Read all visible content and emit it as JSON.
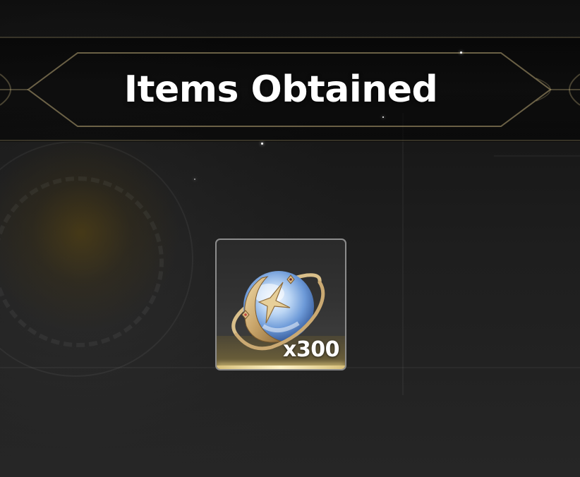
{
  "dialog": {
    "title": "Items Obtained"
  },
  "items": [
    {
      "icon": "moon-orb-icon",
      "quantity": "x300"
    }
  ],
  "colors": {
    "title_text": "#ffffff",
    "banner_gold": "#b9a877",
    "card_border": "#8c8c8c",
    "card_glow": "#fff4c8"
  }
}
